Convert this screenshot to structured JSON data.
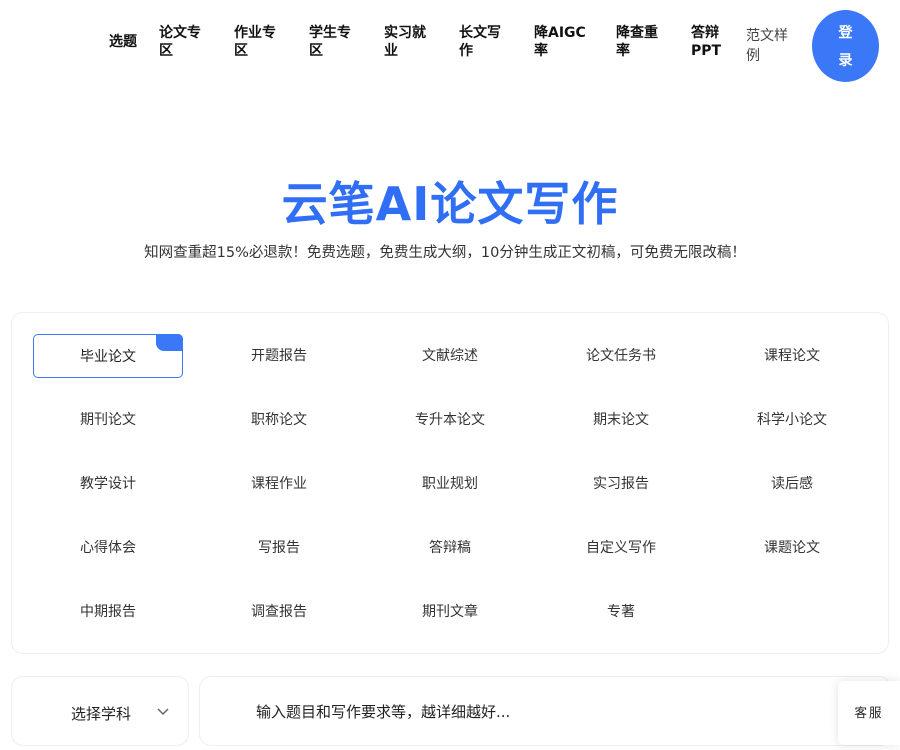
{
  "nav": {
    "items": [
      {
        "label": "选题"
      },
      {
        "label": "论文专区"
      },
      {
        "label": "作业专区"
      },
      {
        "label": "学生专区"
      },
      {
        "label": "实习就业"
      },
      {
        "label": "长文写作"
      },
      {
        "label": "降AIGC率"
      },
      {
        "label": "降查重率"
      },
      {
        "label": "答辩PPT"
      },
      {
        "label": "范文样例"
      }
    ],
    "login_label": "登录"
  },
  "hero": {
    "title": "云笔AI论文写作",
    "subtitle": "知网查重超15%必退款！免费选题，免费生成大纲，10分钟生成正文初稿，可免费无限改稿！"
  },
  "categories": [
    "毕业论文",
    "开题报告",
    "文献综述",
    "论文任务书",
    "课程论文",
    "期刊论文",
    "职称论文",
    "专升本论文",
    "期末论文",
    "科学小论文",
    "教学设计",
    "课程作业",
    "职业规划",
    "实习报告",
    "读后感",
    "心得体会",
    "写报告",
    "答辩稿",
    "自定义写作",
    "课题论文",
    "中期报告",
    "调查报告",
    "期刊文章",
    "专著"
  ],
  "active_category": "毕业论文",
  "subject_select": {
    "label": "选择学科",
    "icon": "chevron-down-icon"
  },
  "prompt": {
    "placeholder": "输入题目和写作要求等，越详细越好..."
  },
  "service": {
    "label": "客服"
  },
  "colors": {
    "accent": "#3b78f7",
    "title": "#2f6ef5"
  }
}
